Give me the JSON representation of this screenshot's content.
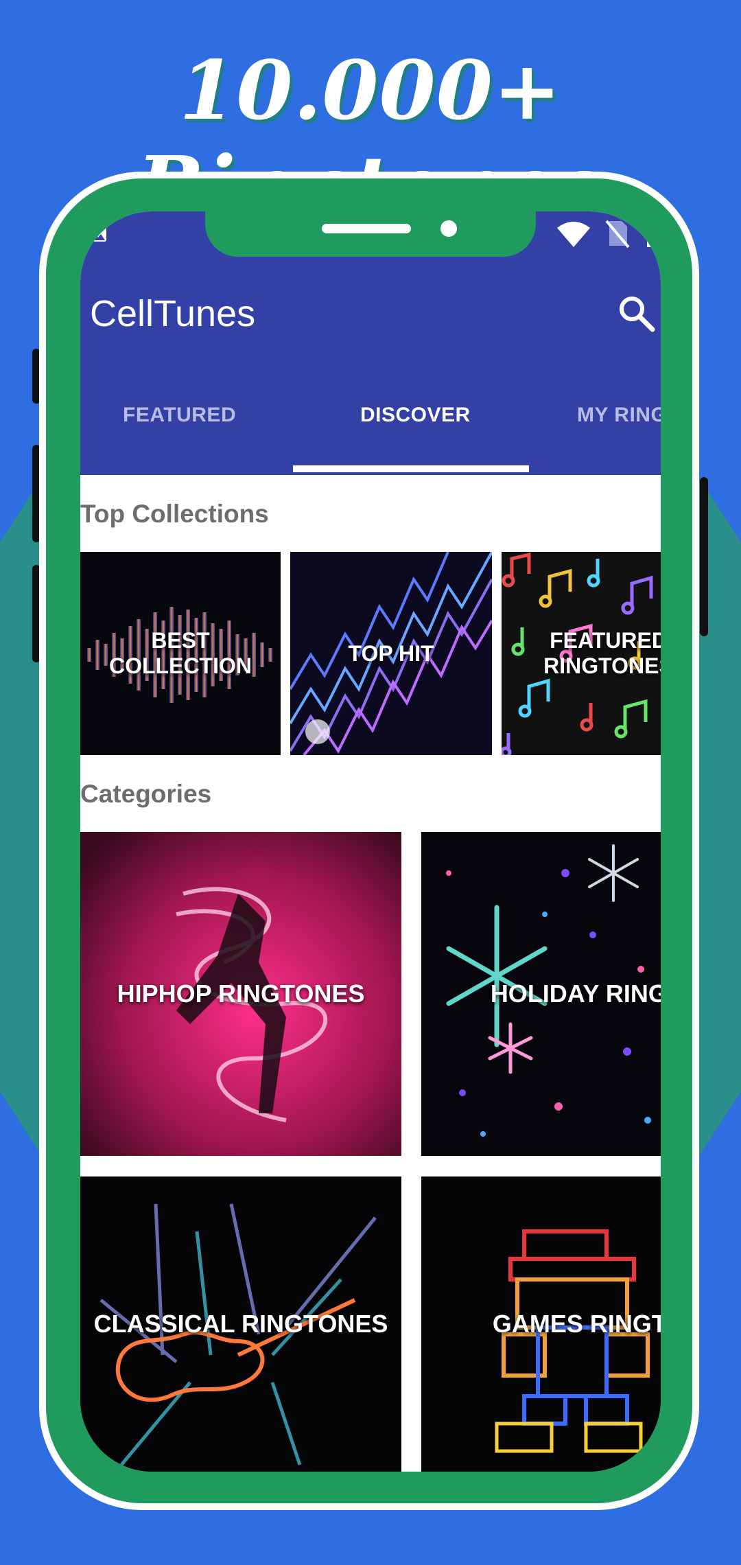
{
  "promo": {
    "headline": "10.000+ Ringtones"
  },
  "app": {
    "title": "CellTunes",
    "tabs": [
      {
        "label": "FEATURED",
        "active": false
      },
      {
        "label": "DISCOVER",
        "active": true
      },
      {
        "label": "MY RING",
        "active": false
      }
    ]
  },
  "sections": {
    "top_collections": {
      "title": "Top Collections",
      "items": [
        {
          "label": "BEST\nCOLLECTION"
        },
        {
          "label": "TOP HIT"
        },
        {
          "label": "FEATURED\nRINGTONES"
        }
      ]
    },
    "categories": {
      "title": "Categories",
      "items": [
        {
          "label": "HIPHOP RINGTONES"
        },
        {
          "label": "HOLIDAY RINGTO"
        },
        {
          "label": "CLASSICAL RINGTONES"
        },
        {
          "label": "GAMES RINGTOI"
        }
      ]
    }
  },
  "icons": {
    "status": [
      "image-icon",
      "wifi-icon",
      "no-sim-icon",
      "battery-icon"
    ],
    "search": "search-icon"
  },
  "colors": {
    "page_bg": "#2f6ee0",
    "phone_frame": "#1f9c5d",
    "app_bar": "#3341a6",
    "section_title": "#6d6d6d"
  }
}
